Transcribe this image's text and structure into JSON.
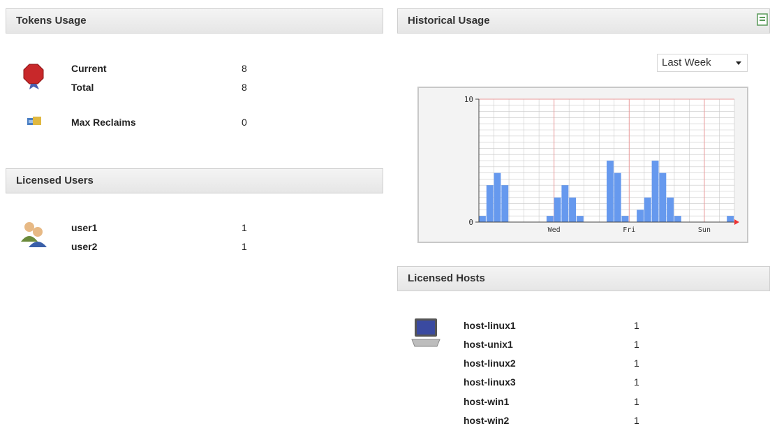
{
  "tokens_usage": {
    "title": "Tokens Usage",
    "rows": [
      {
        "label": "Current",
        "value": "8"
      },
      {
        "label": "Total",
        "value": "8"
      },
      {
        "label": "Max Reclaims",
        "value": "0"
      }
    ]
  },
  "licensed_users": {
    "title": "Licensed Users",
    "rows": [
      {
        "label": "user1",
        "value": "1"
      },
      {
        "label": "user2",
        "value": "1"
      }
    ]
  },
  "historical_usage": {
    "title": "Historical Usage",
    "range_select": "Last Week"
  },
  "licensed_hosts": {
    "title": "Licensed Hosts",
    "rows": [
      {
        "label": "host-linux1",
        "value": "1"
      },
      {
        "label": "host-unix1",
        "value": "1"
      },
      {
        "label": "host-linux2",
        "value": "1"
      },
      {
        "label": "host-linux3",
        "value": "1"
      },
      {
        "label": "host-win1",
        "value": "1"
      },
      {
        "label": "host-win2",
        "value": "1"
      }
    ]
  },
  "chart_data": {
    "type": "bar",
    "ylim": [
      0,
      10
    ],
    "y_ticks": [
      "10",
      "0"
    ],
    "x_tick_labels": [
      "Wed",
      "Fri",
      "Sun"
    ],
    "grid": true,
    "bar_color": "#6699ee",
    "bins": 34,
    "x_label_bins": [
      10,
      20,
      30
    ],
    "values": [
      0.5,
      3,
      4,
      3,
      0,
      0,
      0,
      0,
      0,
      0.5,
      2,
      3,
      2,
      0.5,
      0,
      0,
      0,
      5,
      4,
      0.5,
      0,
      1,
      2,
      5,
      4,
      2,
      0.5,
      0,
      0,
      0,
      0,
      0,
      0,
      0.5
    ]
  }
}
